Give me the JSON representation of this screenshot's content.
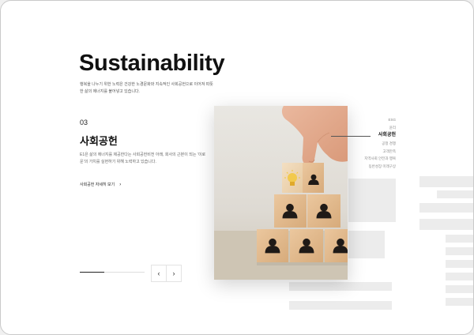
{
  "header": {
    "title": "Sustainability"
  },
  "intro": {
    "text": "행복을 나누기 위한 노력은 건강한 노경문화와 지속적인 사회공헌으로 이어져 따뜻한 삶의 에너지를 불어넣고 있습니다."
  },
  "section": {
    "number": "03",
    "title": "사회공헌",
    "description": "E1은 삶의 에너지를 제공한다는 사회공헌비전 아래, 회사의 근본이 되는 ‘이로운’의 가치를 실현하기 위해 노력하고 있습니다.",
    "more_label": "사회공헌 자세히 보기",
    "more_icon": "chevron-right-icon"
  },
  "slider": {
    "progress": 0.38,
    "prev_icon": "chevron-left-icon",
    "next_icon": "chevron-right-icon",
    "prev_glyph": "‹",
    "next_glyph": "›"
  },
  "side_nav": {
    "items": [
      {
        "label": "ESG",
        "active": false
      },
      {
        "label": "윤리",
        "active": false
      },
      {
        "label": "사회공헌",
        "active": true
      },
      {
        "label": "공정 경쟁",
        "active": false
      },
      {
        "label": "고객만족",
        "active": false
      },
      {
        "label": "지역사회 안전과 행복",
        "active": false
      },
      {
        "label": "동반성장 미래구상",
        "active": false
      }
    ]
  },
  "colors": {
    "accent": "#111111",
    "block": "#e2b98a",
    "bulb": "#f2c94c",
    "muted": "#888888"
  }
}
